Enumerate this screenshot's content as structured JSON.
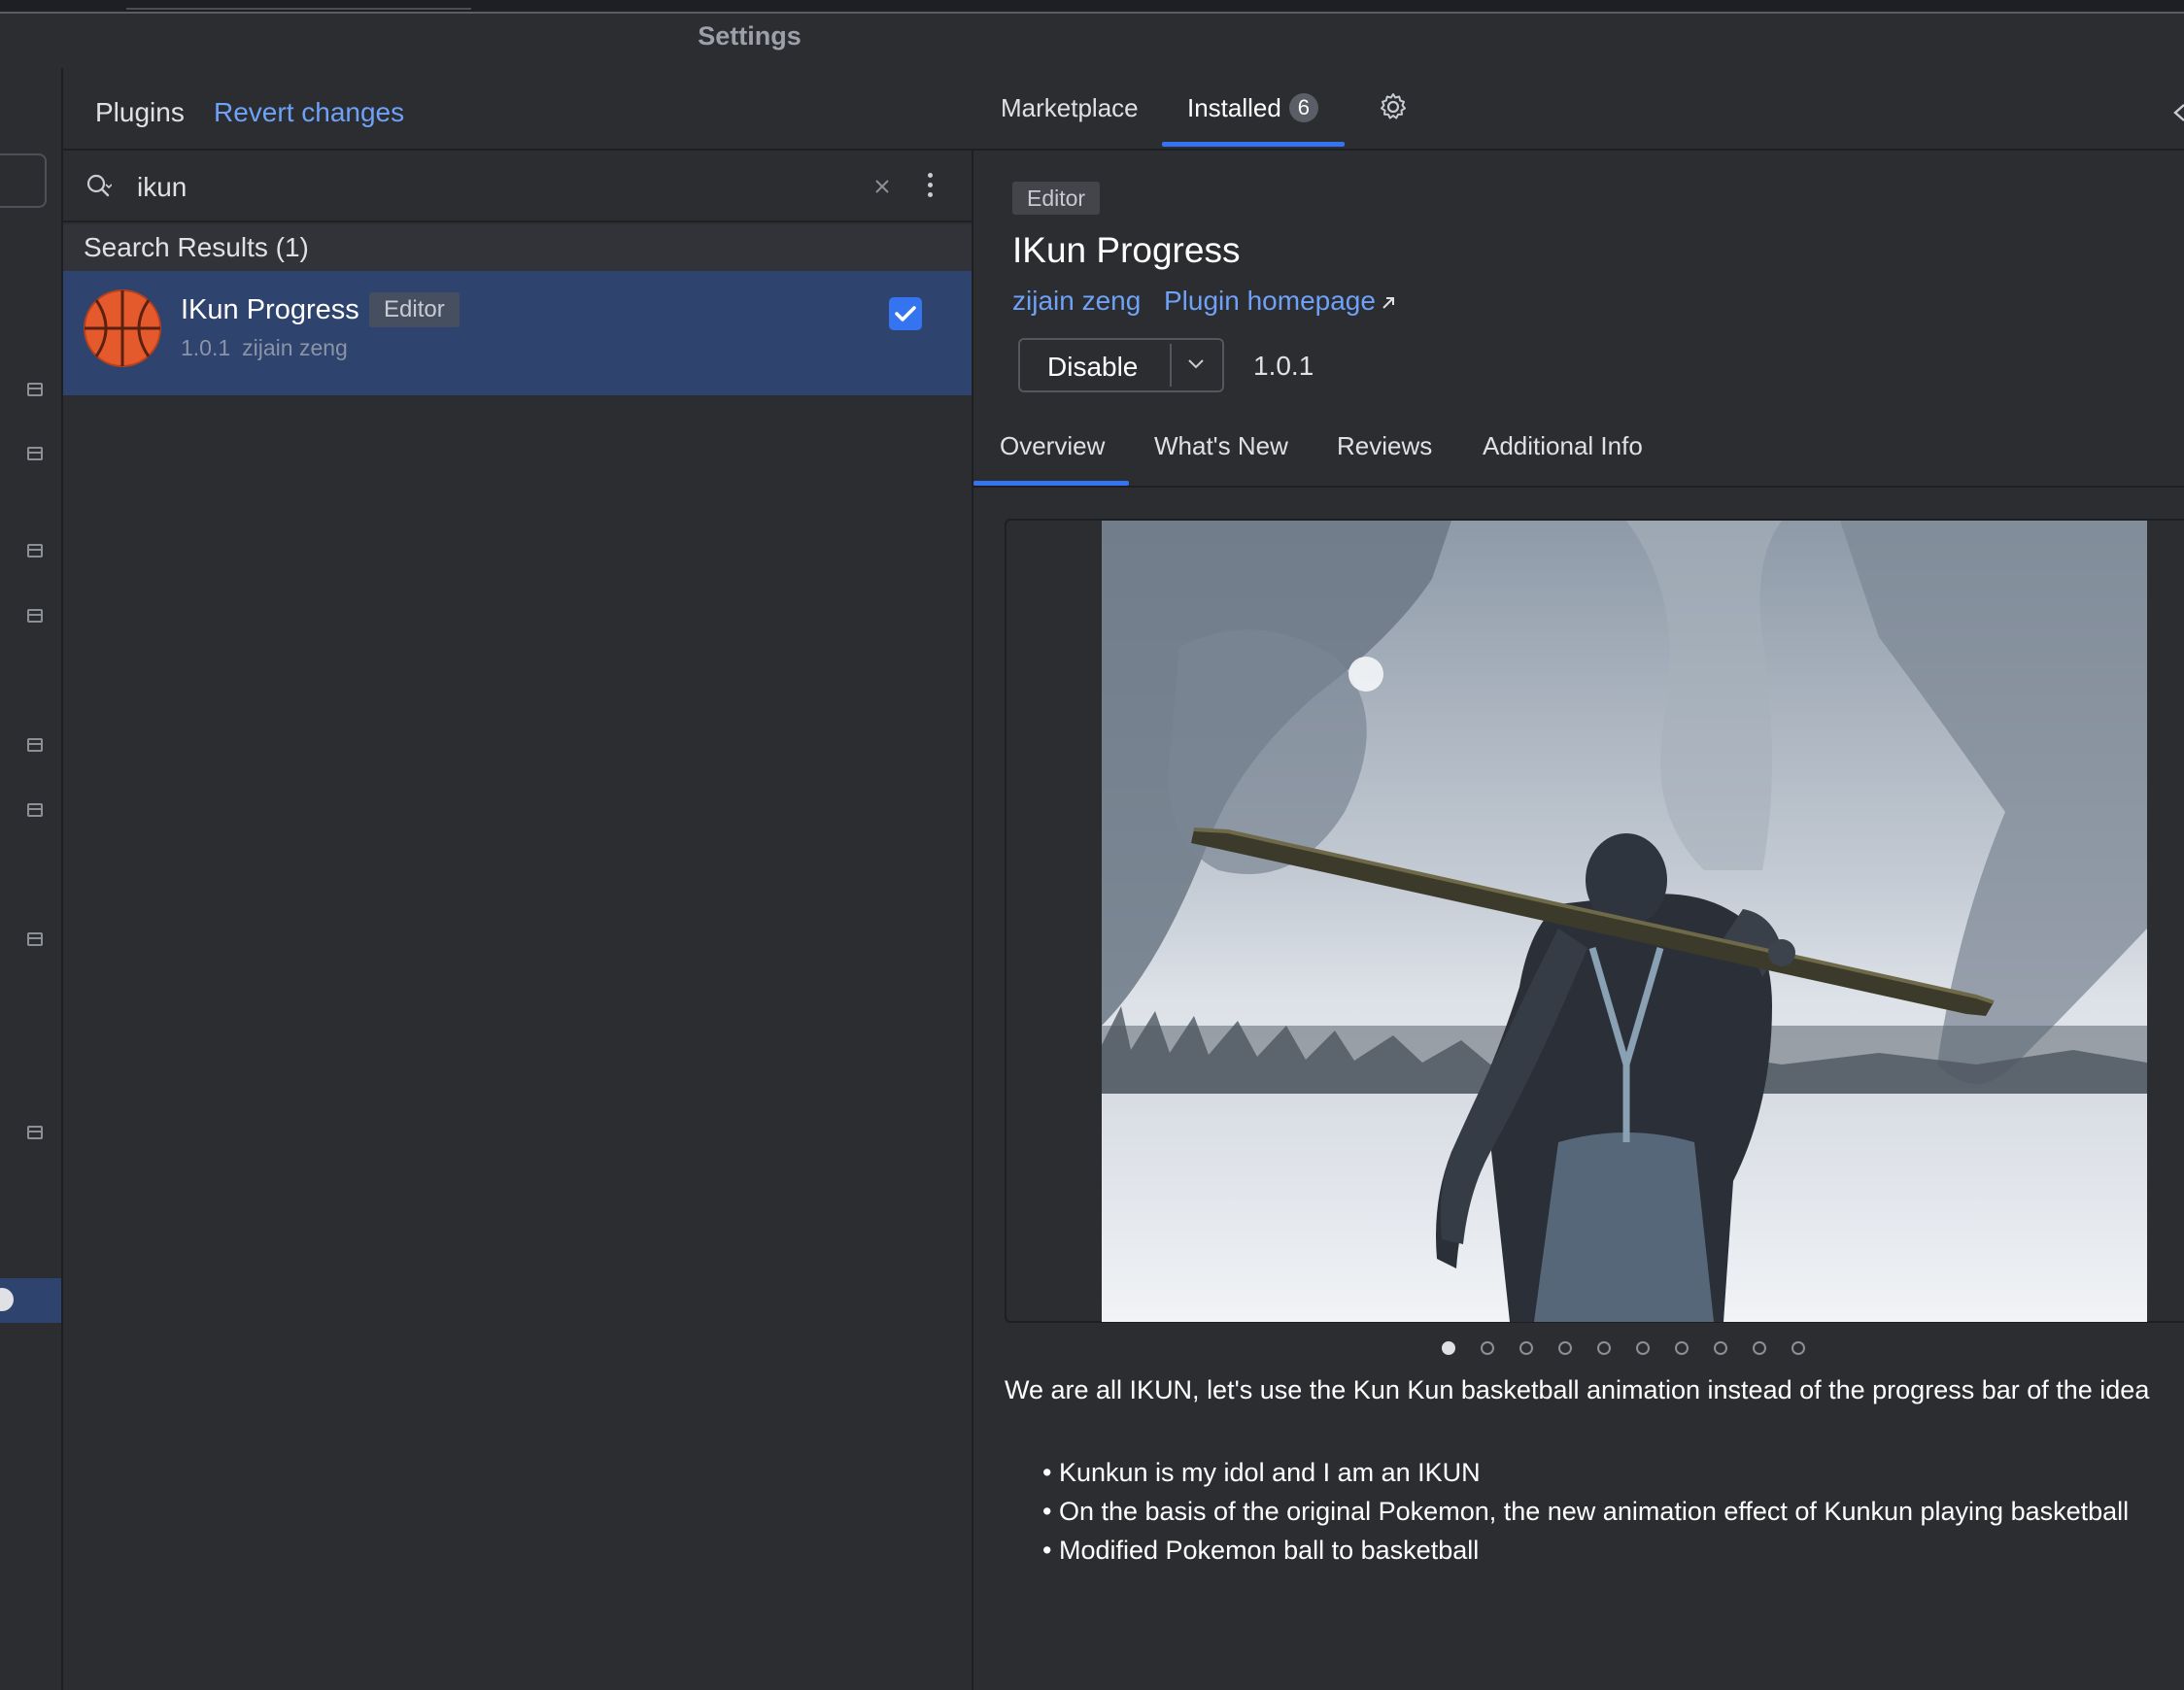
{
  "window": {
    "title": "Settings"
  },
  "plugins": {
    "title": "Plugins",
    "revert_label": "Revert changes",
    "search": {
      "value": "ikun",
      "placeholder": ""
    },
    "results_header": "Search Results (1)",
    "results": [
      {
        "name": "IKun Progress",
        "tag": "Editor",
        "version": "1.0.1",
        "author": "zijain zeng",
        "enabled": true
      }
    ]
  },
  "tabs": {
    "marketplace": "Marketplace",
    "installed": "Installed",
    "installed_count": "6"
  },
  "detail": {
    "tag": "Editor",
    "title": "IKun Progress",
    "author": "zijain zeng",
    "homepage_label": "Plugin homepage",
    "disable_label": "Disable",
    "version": "1.0.1",
    "tabs": [
      "Overview",
      "What's New",
      "Reviews",
      "Additional Info"
    ],
    "active_tab": "Overview",
    "carousel": {
      "total": 10,
      "active_index": 0
    },
    "description": "We are all IKUN, let's use the Kun Kun basketball animation instead of the progress bar of the idea",
    "features": [
      "Kunkun is my idol and I am an IKUN",
      "On the basis of the original Pokemon, the new animation effect of Kunkun playing basketball",
      "Modified Pokemon ball to basketball"
    ]
  },
  "colors": {
    "background": "#2b2d30",
    "selection": "#2e436e",
    "accent": "#3574f0",
    "link": "#6ea1f7",
    "basketball": "#e45a2c"
  },
  "icons": [
    "search-icon",
    "clear-icon",
    "more-vertical-icon",
    "basketball-icon",
    "check-icon",
    "gear-icon",
    "chevron-down-icon",
    "external-link-icon",
    "back-arrow-icon",
    "rail-item-icon"
  ]
}
